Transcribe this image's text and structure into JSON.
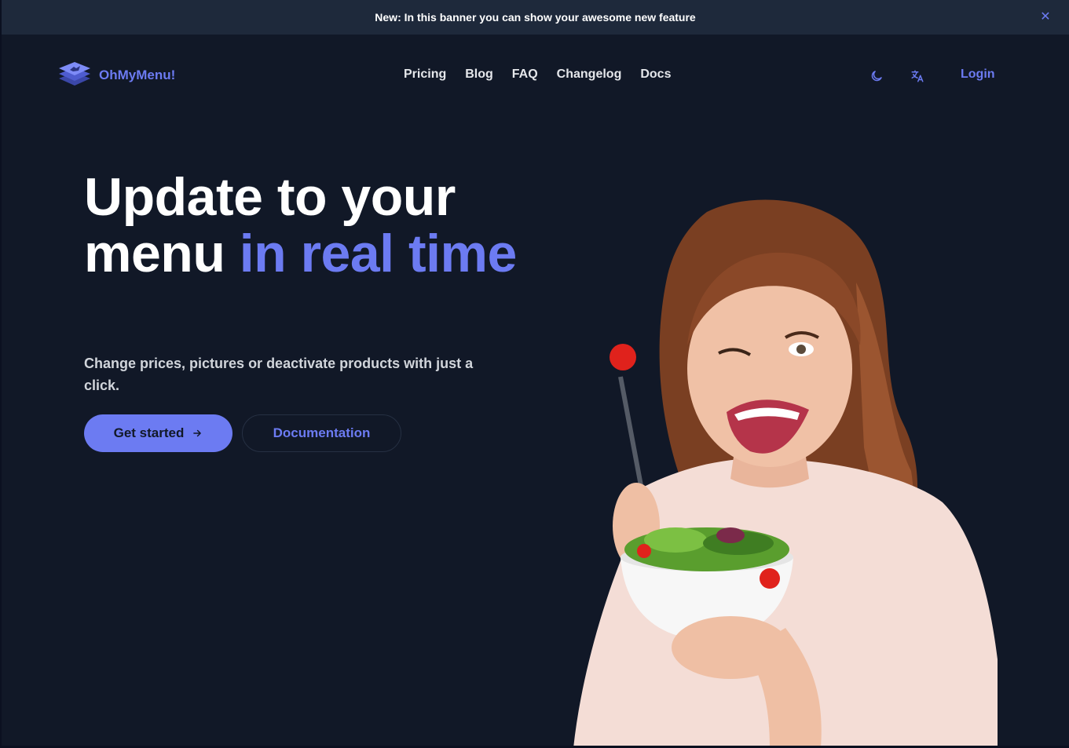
{
  "banner": {
    "text": "New: In this banner you can show your awesome new feature",
    "close_icon": "close-icon"
  },
  "brand": {
    "name": "OhMyMenu!",
    "accent": "#6c7bf2",
    "logo_icon": "stacked-layers-logo-icon"
  },
  "nav": {
    "links": [
      "Pricing",
      "Blog",
      "FAQ",
      "Changelog",
      "Docs"
    ],
    "theme_icon": "moon-icon",
    "language_icon": "translate-icon",
    "login_label": "Login"
  },
  "hero": {
    "title_part1": "Update to your menu ",
    "title_accent": "in real time",
    "subtitle": "Change prices, pictures or deactivate products with just a click.",
    "primary_button": "Get started",
    "primary_button_icon": "arrow-right-icon",
    "secondary_button": "Documentation",
    "image": "woman-eating-salad-photo"
  },
  "colors": {
    "background": "#111827",
    "banner": "#1e293b",
    "accent": "#6c7bf2"
  }
}
